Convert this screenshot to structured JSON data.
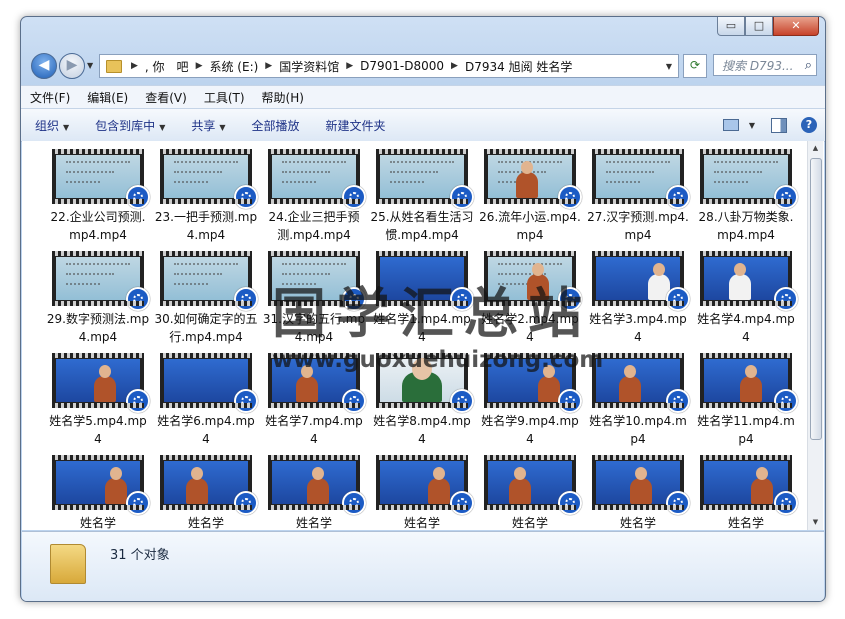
{
  "window": {
    "caption_buttons": {
      "minimize": "▭",
      "maximize": "□",
      "close": "✕"
    }
  },
  "address": {
    "crumbs": [
      ", 你　吧",
      "系统 (E:)",
      "国学资料馆",
      "D7901-D8000",
      "D7934 旭阅 姓名学"
    ],
    "search_placeholder": "搜索 D793..."
  },
  "menu": [
    "文件(F)",
    "编辑(E)",
    "查看(V)",
    "工具(T)",
    "帮助(H)"
  ],
  "toolbar": {
    "organize": "组织",
    "include_in_library": "包含到库中",
    "share": "共享",
    "play_all": "全部播放",
    "new_folder": "新建文件夹"
  },
  "files": [
    {
      "name": "22.企业公司预测.mp4.mp4",
      "thumb": "board"
    },
    {
      "name": "23.一把手预测.mp4.mp4",
      "thumb": "board"
    },
    {
      "name": "24.企业三把手预测.mp4.mp4",
      "thumb": "board"
    },
    {
      "name": "25.从姓名看生活习惯.mp4.mp4",
      "thumb": "board"
    },
    {
      "name": "26.流年小运.mp4.mp4",
      "thumb": "board-person"
    },
    {
      "name": "27.汉字预测.mp4.mp4",
      "thumb": "board"
    },
    {
      "name": "28.八卦万物类象.mp4.mp4",
      "thumb": "board"
    },
    {
      "name": "29.数字预测法.mp4.mp4",
      "thumb": "board"
    },
    {
      "name": "30.如何确定字的五行.mp4.mp4",
      "thumb": "board"
    },
    {
      "name": "31.汉字的五行.mp4.mp4",
      "thumb": "board"
    },
    {
      "name": "姓名学1.mp4.mp4",
      "thumb": "blue"
    },
    {
      "name": "姓名学2.mp4.mp4",
      "thumb": "board-person"
    },
    {
      "name": "姓名学3.mp4.mp4",
      "thumb": "blue-white"
    },
    {
      "name": "姓名学4.mp4.mp4",
      "thumb": "blue-white"
    },
    {
      "name": "姓名学5.mp4.mp4",
      "thumb": "blue-person"
    },
    {
      "name": "姓名学6.mp4.mp4",
      "thumb": "blue"
    },
    {
      "name": "姓名学7.mp4.mp4",
      "thumb": "blue-person"
    },
    {
      "name": "姓名学8.mp4.mp4",
      "thumb": "face"
    },
    {
      "name": "姓名学9.mp4.mp4",
      "thumb": "blue-person"
    },
    {
      "name": "姓名学10.mp4.mp4",
      "thumb": "blue-person"
    },
    {
      "name": "姓名学11.mp4.mp4",
      "thumb": "blue-person"
    },
    {
      "name": "姓名学",
      "thumb": "blue-person"
    },
    {
      "name": "姓名学",
      "thumb": "blue-person"
    },
    {
      "name": "姓名学",
      "thumb": "blue-person"
    },
    {
      "name": "姓名学",
      "thumb": "blue-person"
    },
    {
      "name": "姓名学",
      "thumb": "blue-person"
    },
    {
      "name": "姓名学",
      "thumb": "blue-person"
    },
    {
      "name": "姓名学",
      "thumb": "blue-person"
    }
  ],
  "watermark": {
    "text": "国学汇总站",
    "url": "www.guoxuehuizong.com"
  },
  "status": {
    "count": "31 个对象"
  }
}
